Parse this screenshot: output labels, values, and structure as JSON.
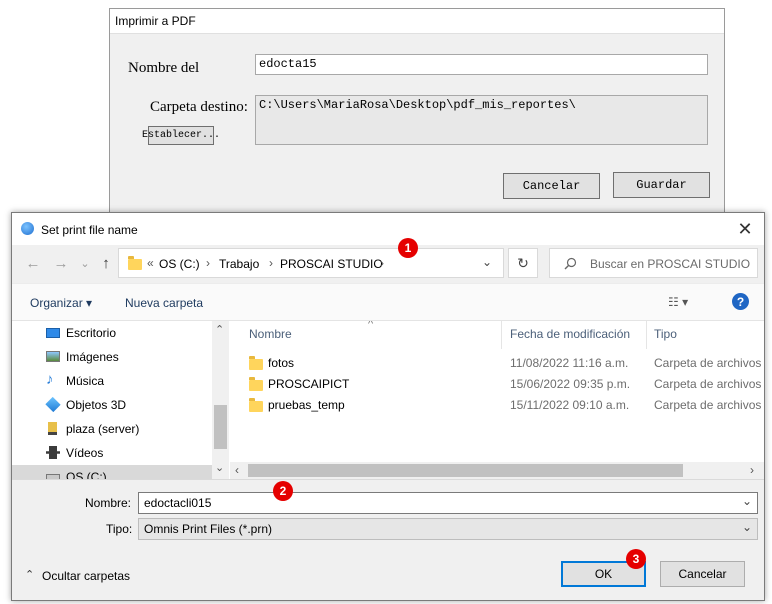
{
  "pdf_dialog": {
    "title": "Imprimir a PDF",
    "name_label": "Nombre del",
    "name_value": "edocta15",
    "dest_label": "Carpeta destino:",
    "dest_value": "C:\\Users\\MariaRosa\\Desktop\\pdf_mis_reportes\\",
    "set_button": "Establecer...",
    "cancel_button": "Cancelar",
    "save_button": "Guardar"
  },
  "save_dialog": {
    "title": "Set print file name",
    "close_glyph": "✕",
    "nav": {
      "back": "←",
      "forward": "→",
      "up": "↑",
      "dropdown": "⌄"
    },
    "breadcrumb": {
      "prefix": "«",
      "items": [
        "OS (C:)",
        "Trabajo",
        "PROSCAI STUDIO"
      ],
      "separator": "›"
    },
    "refresh_glyph": "↻",
    "search_placeholder": "Buscar en PROSCAI STUDIO",
    "toolbar": {
      "organize": "Organizar ▾",
      "new_folder": "Nueva carpeta",
      "view_glyph": "☷ ▾",
      "help": "?"
    },
    "tree": [
      {
        "label": "Escritorio",
        "icon": "desktop-icon"
      },
      {
        "label": "Imágenes",
        "icon": "pictures-icon"
      },
      {
        "label": "Música",
        "icon": "music-icon"
      },
      {
        "label": "Objetos 3D",
        "icon": "3d-objects-icon"
      },
      {
        "label": "plaza (server)",
        "icon": "network-drive-icon"
      },
      {
        "label": "Vídeos",
        "icon": "videos-icon"
      },
      {
        "label": "OS (C:)",
        "icon": "drive-icon"
      }
    ],
    "columns": {
      "name": "Nombre",
      "date": "Fecha de modificación",
      "type": "Tipo"
    },
    "files": [
      {
        "name": "fotos",
        "date": "11/08/2022 11:16 a.m.",
        "type": "Carpeta de archivos"
      },
      {
        "name": "PROSCAIPICT",
        "date": "15/06/2022 09:35 p.m.",
        "type": "Carpeta de archivos"
      },
      {
        "name": "pruebas_temp",
        "date": "15/11/2022 09:10 a.m.",
        "type": "Carpeta de archivos"
      }
    ],
    "filename_label": "Nombre:",
    "filename_value": "edoctacli015",
    "type_label": "Tipo:",
    "type_value": "Omnis Print Files (*.prn)",
    "hide_folders": "Ocultar carpetas",
    "ok_button": "OK",
    "cancel_button": "Cancelar"
  },
  "annotations": [
    "1",
    "2",
    "3"
  ],
  "colors": {
    "accent": "#0078d7",
    "badge": "#e50000",
    "folder": "#ffd55c"
  }
}
